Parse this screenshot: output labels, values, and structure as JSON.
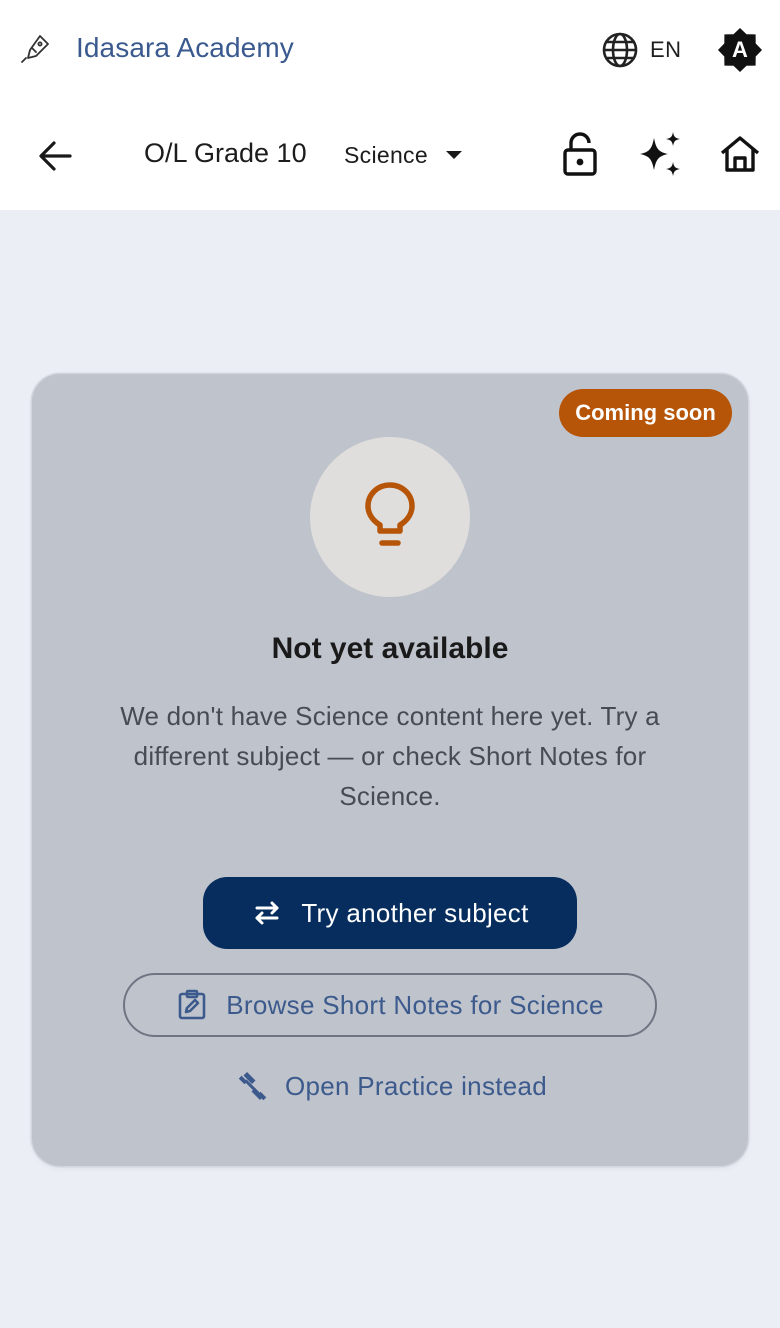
{
  "app": {
    "title": "Idasara Academy",
    "language": "EN",
    "theme_badge": "A"
  },
  "header": {
    "grade": "O/L Grade 10",
    "subject": "Science"
  },
  "card": {
    "badge": "Coming soon",
    "title": "Not yet available",
    "description": "We don't have Science content here yet. Try a different subject — or check Short Notes for Science.",
    "primary_button": "Try another subject",
    "secondary_button": "Browse Short Notes for Science",
    "text_button": "Open Practice instead"
  },
  "colors": {
    "brand": "#3a5a8f",
    "badge": "#b65408",
    "primary": "#062d5e",
    "card_bg": "#bfc3cc",
    "page_bg": "#ebeef5"
  },
  "icons": [
    "pen-nib-icon",
    "globe-icon",
    "auto-theme-icon",
    "back-arrow-icon",
    "caret-down-icon",
    "lock-open-icon",
    "sparkle-icon",
    "home-icon",
    "lightbulb-icon",
    "swap-icon",
    "edit-note-icon",
    "dumbbell-icon"
  ]
}
